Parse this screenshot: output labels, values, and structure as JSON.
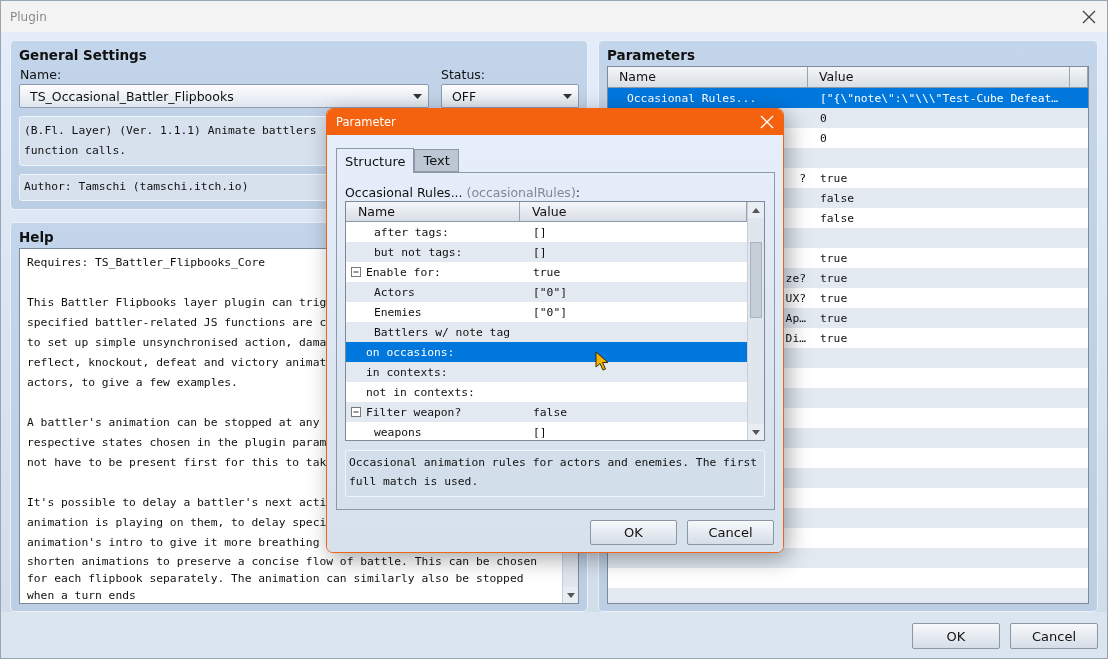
{
  "window": {
    "title": "Plugin"
  },
  "general": {
    "heading": "General Settings",
    "name_label": "Name:",
    "name_value": "TS_Occasional_Battler_Flipbooks",
    "status_label": "Status:",
    "status_value": "OFF",
    "description": [
      "(B.Fl. Layer) (Ver. 1.1.1) Animate battlers",
      "function calls."
    ],
    "author": "Author: Tamschi (tamschi.itch.io)"
  },
  "help": {
    "heading": "Help",
    "paragraphs": [
      [
        "Requires: TS_Battler_Flipbooks_Core"
      ],
      [
        "This Battler Flipbooks layer plugin can trig",
        "specified battler-related JS functions are c",
        "to set up simple unsynchronised action, dama",
        "reflect, knockout, defeat and victory animat",
        "actors, to give a few examples."
      ],
      [
        "A battler's animation can be stopped at any",
        "respective states chosen in the plugin param",
        "not have to be present first for this to tak"
      ],
      [
        "It's possible to delay a battler's next acti",
        "animation is playing on them, to delay speci",
        "animation's intro to give it more breathing",
        "shorten animations to preserve a concise flow of battle. This can be chosen",
        "for each flipbook separately. The animation can similarly also be stopped",
        "when a turn ends"
      ]
    ]
  },
  "parameters": {
    "heading": "Parameters",
    "columns": [
      "Name",
      "Value"
    ],
    "rows": [
      {
        "name": "Occasional Rules...",
        "value": "[\"{\\\"note\\\":\\\"\\\\\\\"Test-Cube Defeat…",
        "selected": true,
        "cut": false
      },
      {
        "value": "0",
        "selected": false
      },
      {
        "value": "0",
        "selected": false
      },
      {
        "selected": false
      },
      {
        "name": "?",
        "value": "true",
        "selected": false,
        "cut": true
      },
      {
        "value": "false",
        "selected": false
      },
      {
        "value": "false",
        "selected": false
      },
      {
        "selected": false
      },
      {
        "value": "true",
        "selected": false
      },
      {
        "name": "ze?",
        "value": "true",
        "selected": false,
        "cut": true
      },
      {
        "name": "UX?",
        "value": "true",
        "selected": false,
        "cut": true
      },
      {
        "name": "Ap…",
        "value": "true",
        "selected": false,
        "cut": true
      },
      {
        "name": "Di…",
        "value": "true",
        "selected": false,
        "cut": true
      }
    ]
  },
  "dialog": {
    "title": "Parameter",
    "tabs": [
      {
        "label": "Structure",
        "selected": true
      },
      {
        "label": "Text",
        "selected": false
      }
    ],
    "label": "Occasional Rules...",
    "key": "(occasionalRules)",
    "suffix": ":",
    "columns": [
      "Name",
      "Value"
    ],
    "tree": [
      {
        "children": [
          {
            "name": "after tags:",
            "value": "[]",
            "selected": false
          },
          {
            "name": "but not tags:",
            "value": "[]",
            "selected": false
          }
        ]
      },
      {
        "name": "Enable for:",
        "value": "true",
        "selected": false,
        "expanded": true,
        "children": [
          {
            "name": "Actors",
            "value": "[\"0\"]",
            "selected": false
          },
          {
            "name": "Enemies",
            "value": "[\"0\"]",
            "selected": false
          },
          {
            "name": "Battlers w/ note tag",
            "selected": false
          }
        ]
      },
      {
        "name": "on occasions:",
        "selected": true
      },
      {
        "name": "in contexts:",
        "selected": false
      },
      {
        "name": "not in contexts:",
        "selected": false
      },
      {
        "name": "Filter weapon?",
        "value": "false",
        "selected": false,
        "expanded": true,
        "children": [
          {
            "name": "weapons",
            "value": "[]",
            "selected": false
          }
        ]
      }
    ],
    "description": [
      "Occasional animation rules for actors and enemies. The first",
      "full match is used."
    ],
    "buttons": [
      "OK",
      "Cancel"
    ]
  },
  "buttons": [
    "OK",
    "Cancel"
  ]
}
